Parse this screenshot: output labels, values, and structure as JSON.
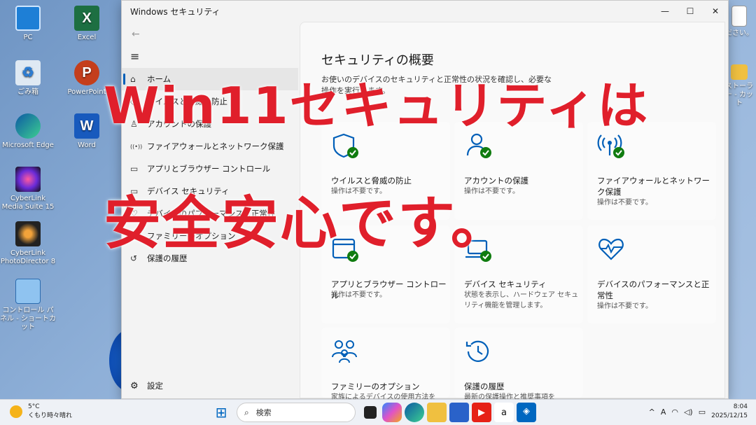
{
  "desktop": {
    "icons": [
      {
        "label": "PC"
      },
      {
        "label": "Excel",
        "glyph": "X"
      },
      {
        "label": "ごみ箱"
      },
      {
        "label": "PowerPoint",
        "glyph": "P"
      },
      {
        "label": "Microsoft Edge"
      },
      {
        "label": "Word",
        "glyph": "W"
      },
      {
        "label": "CyberLink Media Suite 15"
      },
      {
        "label": "CyberLink PhotoDirector 8"
      },
      {
        "label": "コントロール パネル - ショートカット"
      },
      {
        "label": "ださい。"
      },
      {
        "label": "ストーラー - カット"
      }
    ]
  },
  "window": {
    "title": "Windows セキュリティ",
    "minimize": "—",
    "maximize": "☐",
    "close": "✕"
  },
  "sidebar": {
    "back": "←",
    "menu": "≡",
    "items": [
      {
        "label": "ホーム",
        "icon": "home-icon",
        "glyph": "⌂"
      },
      {
        "label": "ウイルスと脅威の防止",
        "icon": "shield-icon",
        "glyph": "◇"
      },
      {
        "label": "アカウントの保護",
        "icon": "person-icon",
        "glyph": "♙"
      },
      {
        "label": "ファイアウォールとネットワーク保護",
        "icon": "antenna-icon",
        "glyph": "((•))"
      },
      {
        "label": "アプリとブラウザー コントロール",
        "icon": "browser-icon",
        "glyph": "▭"
      },
      {
        "label": "デバイス セキュリティ",
        "icon": "laptop-icon",
        "glyph": "▭"
      },
      {
        "label": "デバイスのパフォーマンスと正常性",
        "icon": "heart-icon",
        "glyph": "♡"
      },
      {
        "label": "ファミリーのオプション",
        "icon": "family-icon",
        "glyph": "♙"
      },
      {
        "label": "保護の履歴",
        "icon": "history-icon",
        "glyph": "↺"
      }
    ],
    "settings": {
      "label": "設定",
      "glyph": "⚙"
    }
  },
  "main": {
    "title": "セキュリティの概要",
    "subtitle": "お使いのデバイスのセキュリティと正常性の状況を確認し、必要な操作を実行します。",
    "cards": [
      {
        "title": "ウイルスと脅威の防止",
        "desc": "操作は不要です。"
      },
      {
        "title": "アカウントの保護",
        "desc": "操作は不要です。"
      },
      {
        "title": "ファイアウォールとネットワーク保護",
        "desc": "操作は不要です。"
      },
      {
        "title": "アプリとブラウザー コントロール",
        "desc": "操作は不要です。"
      },
      {
        "title": "デバイス セキュリティ",
        "desc": "状態を表示し、ハードウェア セキュリティ機能を管理します。"
      },
      {
        "title": "デバイスのパフォーマンスと正常性",
        "desc": "操作は不要です。"
      },
      {
        "title": "ファミリーのオプション",
        "desc": "家族によるデバイスの使用方法を"
      },
      {
        "title": "保護の履歴",
        "desc": "最新の保護操作と推奨事項を"
      }
    ]
  },
  "overlay": {
    "line1": "Win11セキュリティは",
    "line2": "安全安心です。"
  },
  "taskbar": {
    "weather_temp": "5°C",
    "weather_desc": "くもり時々晴れ",
    "search_placeholder": "検索",
    "time": "8:04",
    "date": "2025/12/15",
    "chevron": "^",
    "ime": "A"
  },
  "colors": {
    "accent": "#005fb8",
    "check": "#107c10",
    "overlay_red": "#e01f2b"
  }
}
